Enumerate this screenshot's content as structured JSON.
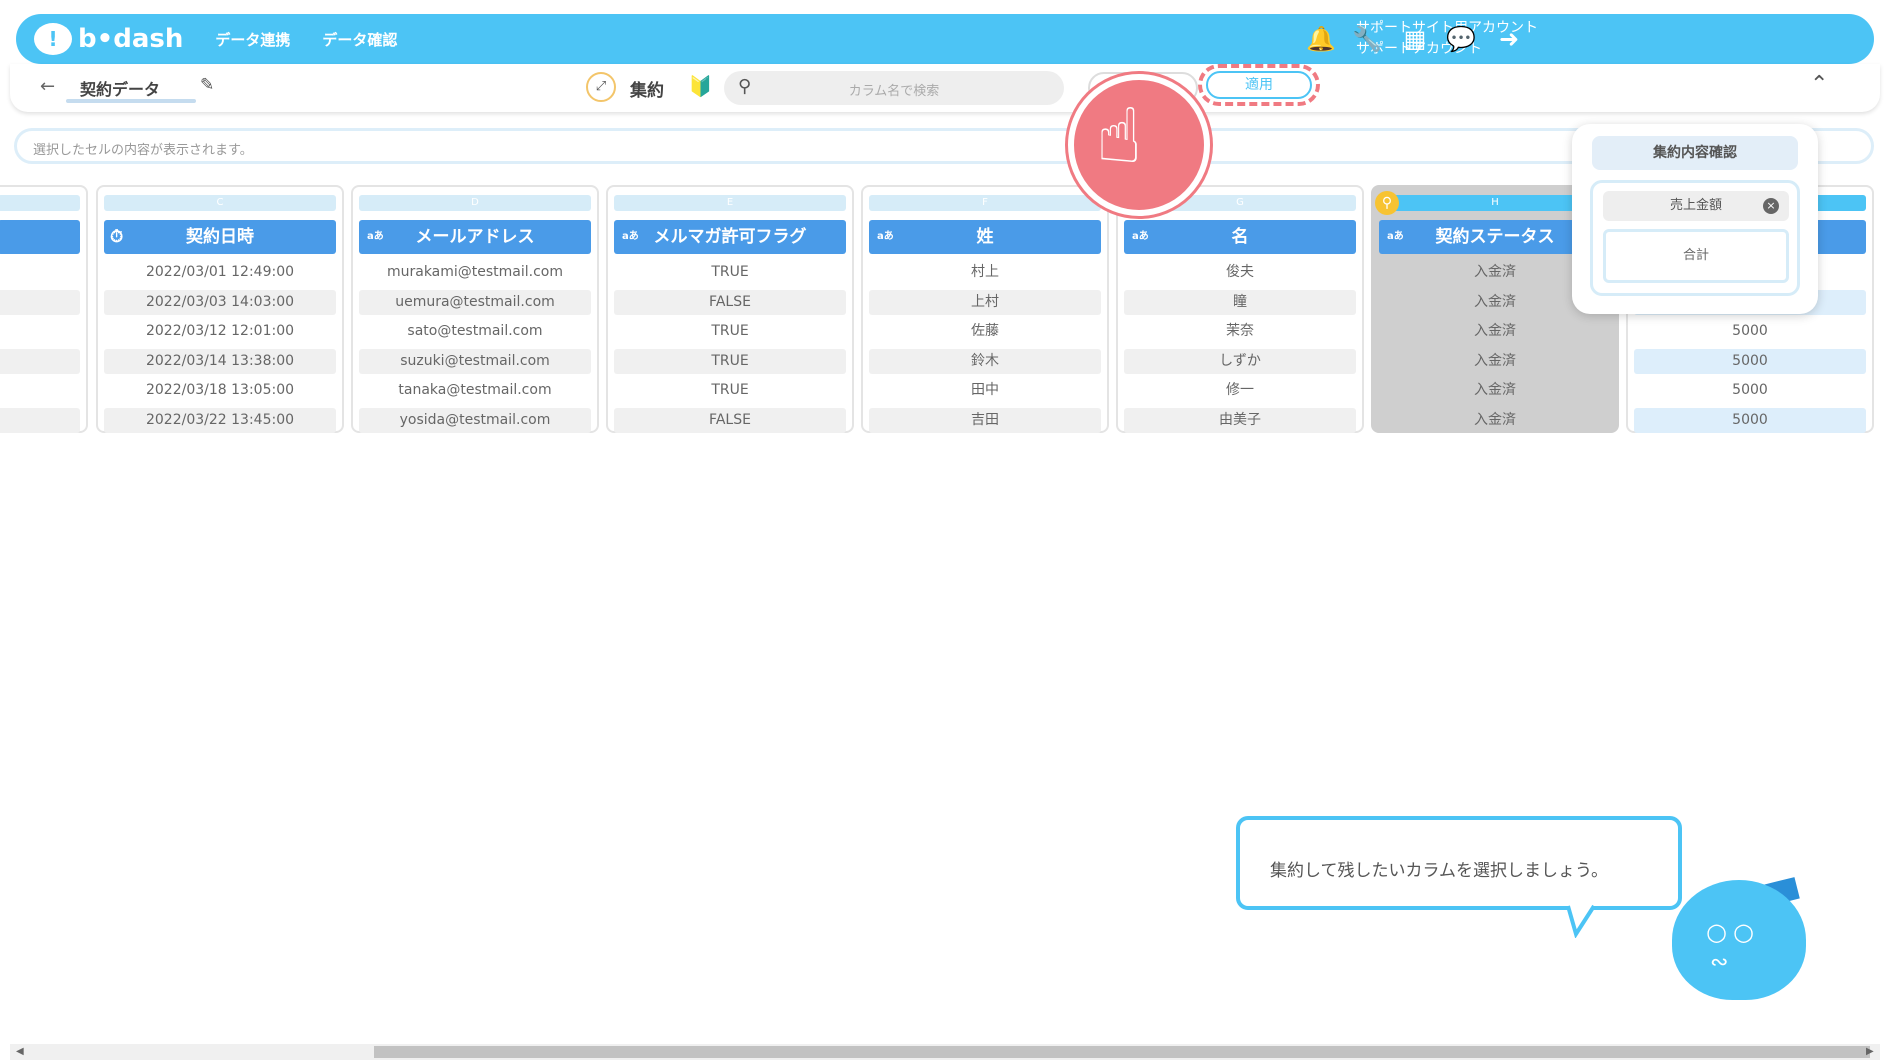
{
  "header": {
    "logo_text": "b•dash",
    "nav": [
      "データ連携",
      "データ確認"
    ],
    "account_line1": "サポートサイト用アカウント",
    "account_line2": "サポートアカウント",
    "icons": [
      "bell-icon",
      "wrench-icon",
      "grid-icon",
      "chat-icon",
      "logout-icon"
    ]
  },
  "subbar": {
    "back_icon": "arrow-left-icon",
    "title": "契約データ",
    "mode_label": "集約",
    "search_placeholder": "カラム名で検索",
    "apply_label": "適用"
  },
  "cellbar": {
    "placeholder": "選択したセルの内容が表示されます。"
  },
  "columns": [
    {
      "letter": "C",
      "name": "契約日時",
      "type": "clock",
      "cells": [
        "2022/03/01 12:49:00",
        "2022/03/03 14:03:00",
        "2022/03/12 12:01:00",
        "2022/03/14 13:38:00",
        "2022/03/18 13:05:00",
        "2022/03/22 13:45:00"
      ]
    },
    {
      "letter": "D",
      "name": "メールアドレス",
      "type": "aあ",
      "cells": [
        "murakami@testmail.com",
        "uemura@testmail.com",
        "sato@testmail.com",
        "suzuki@testmail.com",
        "tanaka@testmail.com",
        "yosida@testmail.com"
      ]
    },
    {
      "letter": "E",
      "name": "メルマガ許可フラグ",
      "type": "aあ",
      "cells": [
        "TRUE",
        "FALSE",
        "TRUE",
        "TRUE",
        "TRUE",
        "FALSE"
      ]
    },
    {
      "letter": "F",
      "name": "姓",
      "type": "aあ",
      "cells": [
        "村上",
        "上村",
        "佐藤",
        "鈴木",
        "田中",
        "吉田"
      ]
    },
    {
      "letter": "G",
      "name": "名",
      "type": "aあ",
      "cells": [
        "俊夫",
        "瞳",
        "茉奈",
        "しずか",
        "修一",
        "由美子"
      ]
    },
    {
      "letter": "H",
      "name": "契約ステータス",
      "type": "aあ",
      "cells": [
        "入金済",
        "入金済",
        "入金済",
        "入金済",
        "入金済",
        "入金済"
      ]
    },
    {
      "letter": "",
      "name": "",
      "type": "",
      "cells": [
        "",
        "",
        "5000",
        "5000",
        "5000",
        "5000"
      ]
    }
  ],
  "popup": {
    "title": "集約内容確認",
    "field": "売上金額",
    "aggregation": "合計"
  },
  "guide": {
    "message": "集約して残したいカラムを選択しましょう。"
  }
}
